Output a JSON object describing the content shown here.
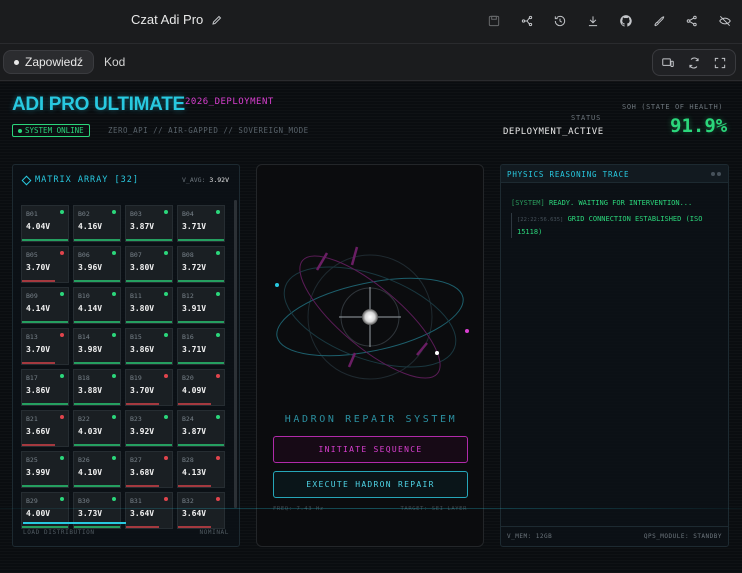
{
  "topbar": {
    "title": "Czat Adi Pro",
    "icons": [
      "save-icon",
      "share-nodes-icon",
      "history-icon",
      "download-icon",
      "github-icon",
      "rocket-icon",
      "share-icon",
      "hide-icon"
    ]
  },
  "tabs": {
    "preview": "Zapowiedź",
    "code": "Kod"
  },
  "header": {
    "brand": "ADI PRO ULTIMATE",
    "deployment": "2026_DEPLOYMENT",
    "online": "SYSTEM ONLINE",
    "modes": "ZERO_API // AIR-GAPPED // SOVEREIGN_MODE",
    "status_label": "STATUS",
    "status_value": "DEPLOYMENT_ACTIVE",
    "soh_label": "SOH (STATE OF HEALTH)",
    "soh_value": "91.9%"
  },
  "matrix": {
    "title": "MATRIX ARRAY [32]",
    "vavg_label": "V_AVG:",
    "vavg_value": "3.92V",
    "load_label": "LOAD DISTRIBUTION",
    "load_status": "NOMINAL",
    "load_fraction": 0.45,
    "colors": {
      "ok": "#2bd67b",
      "warn": "#e0444c"
    },
    "cells": [
      {
        "id": "B01",
        "v": "4.04V",
        "s": "ok"
      },
      {
        "id": "B02",
        "v": "4.16V",
        "s": "ok"
      },
      {
        "id": "B03",
        "v": "3.87V",
        "s": "ok"
      },
      {
        "id": "B04",
        "v": "3.71V",
        "s": "ok"
      },
      {
        "id": "B05",
        "v": "3.70V",
        "s": "warn"
      },
      {
        "id": "B06",
        "v": "3.96V",
        "s": "ok"
      },
      {
        "id": "B07",
        "v": "3.80V",
        "s": "ok"
      },
      {
        "id": "B08",
        "v": "3.72V",
        "s": "ok"
      },
      {
        "id": "B09",
        "v": "4.14V",
        "s": "ok"
      },
      {
        "id": "B10",
        "v": "4.14V",
        "s": "ok"
      },
      {
        "id": "B11",
        "v": "3.80V",
        "s": "ok"
      },
      {
        "id": "B12",
        "v": "3.91V",
        "s": "ok"
      },
      {
        "id": "B13",
        "v": "3.70V",
        "s": "warn"
      },
      {
        "id": "B14",
        "v": "3.98V",
        "s": "ok"
      },
      {
        "id": "B15",
        "v": "3.86V",
        "s": "ok"
      },
      {
        "id": "B16",
        "v": "3.71V",
        "s": "ok"
      },
      {
        "id": "B17",
        "v": "3.86V",
        "s": "ok"
      },
      {
        "id": "B18",
        "v": "3.88V",
        "s": "ok"
      },
      {
        "id": "B19",
        "v": "3.70V",
        "s": "warn"
      },
      {
        "id": "B20",
        "v": "4.09V",
        "s": "warn"
      },
      {
        "id": "B21",
        "v": "3.66V",
        "s": "warn"
      },
      {
        "id": "B22",
        "v": "4.03V",
        "s": "ok"
      },
      {
        "id": "B23",
        "v": "3.92V",
        "s": "ok"
      },
      {
        "id": "B24",
        "v": "3.87V",
        "s": "ok"
      },
      {
        "id": "B25",
        "v": "3.99V",
        "s": "ok"
      },
      {
        "id": "B26",
        "v": "4.10V",
        "s": "ok"
      },
      {
        "id": "B27",
        "v": "3.68V",
        "s": "warn"
      },
      {
        "id": "B28",
        "v": "4.13V",
        "s": "warn"
      },
      {
        "id": "B29",
        "v": "4.00V",
        "s": "ok"
      },
      {
        "id": "B30",
        "v": "3.73V",
        "s": "ok"
      },
      {
        "id": "B31",
        "v": "3.64V",
        "s": "warn"
      },
      {
        "id": "B32",
        "v": "3.64V",
        "s": "warn"
      }
    ]
  },
  "hadron": {
    "title": "HADRON REPAIR SYSTEM",
    "initiate_label": "INITIATE SEQUENCE",
    "execute_label": "EXECUTE HADRON REPAIR",
    "freq": "FREQ: 7.43 Hz",
    "target": "TARGET: SEI LAYER"
  },
  "trace": {
    "title": "PHYSICS REASONING TRACE",
    "system_tag": "[SYSTEM]",
    "system_msg": "READY. WAITING FOR INTERVENTION...",
    "entry_ts": "[22:22:56.635]",
    "entry_msg": "GRID CONNECTION ESTABLISHED (ISO 15118)",
    "vmem": "V_MEM: 12GB",
    "qps": "QPS_MODULE: STANDBY"
  }
}
